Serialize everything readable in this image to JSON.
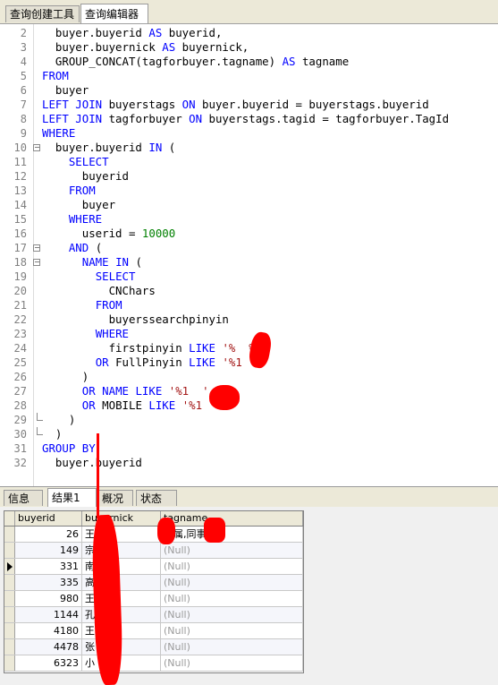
{
  "top_tabs": [
    "查询创建工具",
    "查询编辑器"
  ],
  "editor": {
    "lines": [
      {
        "n": "2",
        "html": "  buyer.buyerid <span class=\"kw\">AS</span> buyerid,"
      },
      {
        "n": "3",
        "html": "  buyer.buyernick <span class=\"kw\">AS</span> buyernick,"
      },
      {
        "n": "4",
        "html": "  GROUP_CONCAT(tagforbuyer.tagname) <span class=\"kw\">AS</span> tagname"
      },
      {
        "n": "5",
        "html": "<span class=\"kw\">FROM</span>"
      },
      {
        "n": "6",
        "html": "  buyer"
      },
      {
        "n": "7",
        "html": "<span class=\"kw\">LEFT JOIN</span> buyerstags <span class=\"kw\">ON</span> buyer.buyerid = buyerstags.buyerid"
      },
      {
        "n": "8",
        "html": "<span class=\"kw\">LEFT JOIN</span> tagforbuyer <span class=\"kw\">ON</span> buyerstags.tagid = tagforbuyer.TagId"
      },
      {
        "n": "9",
        "html": "<span class=\"kw\">WHERE</span>"
      },
      {
        "n": "10",
        "html": "  buyer.buyerid <span class=\"kw\">IN</span> ("
      },
      {
        "n": "11",
        "html": "    <span class=\"kw\">SELECT</span>"
      },
      {
        "n": "12",
        "html": "      buyerid"
      },
      {
        "n": "13",
        "html": "    <span class=\"kw\">FROM</span>"
      },
      {
        "n": "14",
        "html": "      buyer"
      },
      {
        "n": "15",
        "html": "    <span class=\"kw\">WHERE</span>"
      },
      {
        "n": "16",
        "html": "      userid = <span class=\"num\">10000</span>"
      },
      {
        "n": "17",
        "html": "    <span class=\"kw\">AND</span> ("
      },
      {
        "n": "18",
        "html": "      <span class=\"kw\">NAME IN</span> ("
      },
      {
        "n": "19",
        "html": "        <span class=\"kw\">SELECT</span>"
      },
      {
        "n": "20",
        "html": "          CNChars"
      },
      {
        "n": "21",
        "html": "        <span class=\"kw\">FROM</span>"
      },
      {
        "n": "22",
        "html": "          buyerssearchpinyin"
      },
      {
        "n": "23",
        "html": "        <span class=\"kw\">WHERE</span>"
      },
      {
        "n": "24",
        "html": "          firstpinyin <span class=\"kw\">LIKE</span> <span class=\"str\">'%  %'</span>"
      },
      {
        "n": "25",
        "html": "        <span class=\"kw\">OR</span> FullPinyin <span class=\"kw\">LIKE</span> <span class=\"str\">'%1  %'</span>"
      },
      {
        "n": "26",
        "html": "      )"
      },
      {
        "n": "27",
        "html": "      <span class=\"kw\">OR</span> <span class=\"kw\">NAME LIKE</span> <span class=\"str\">'%1  '</span>"
      },
      {
        "n": "28",
        "html": "      <span class=\"kw\">OR</span> MOBILE <span class=\"kw\">LIKE</span> <span class=\"str\">'%1  '</span>"
      },
      {
        "n": "29",
        "html": "    )"
      },
      {
        "n": "30",
        "html": "  )"
      },
      {
        "n": "31",
        "html": "<span class=\"kw\">GROUP BY</span>"
      },
      {
        "n": "32",
        "html": "  buyer.buyerid"
      }
    ]
  },
  "bottom_tabs": [
    "信息",
    "结果1",
    "概况",
    "状态"
  ],
  "grid": {
    "columns": [
      "buyerid",
      "buyernick",
      "tagname"
    ],
    "rows": [
      {
        "buyerid": "26",
        "buyernick": "王",
        "tagname": "家属,同事"
      },
      {
        "buyerid": "149",
        "buyernick": "宗",
        "tagname": "(Null)"
      },
      {
        "buyerid": "331",
        "buyernick": "南",
        "tagname": "(Null)"
      },
      {
        "buyerid": "335",
        "buyernick": "高",
        "tagname": "(Null)"
      },
      {
        "buyerid": "980",
        "buyernick": "王",
        "tagname": "(Null)"
      },
      {
        "buyerid": "1144",
        "buyernick": "孔",
        "tagname": "(Null)"
      },
      {
        "buyerid": "4180",
        "buyernick": "王",
        "tagname": "(Null)"
      },
      {
        "buyerid": "4478",
        "buyernick": "张",
        "tagname": "(Null)"
      },
      {
        "buyerid": "6323",
        "buyernick": "小",
        "tagname": "(Null)"
      }
    ]
  }
}
